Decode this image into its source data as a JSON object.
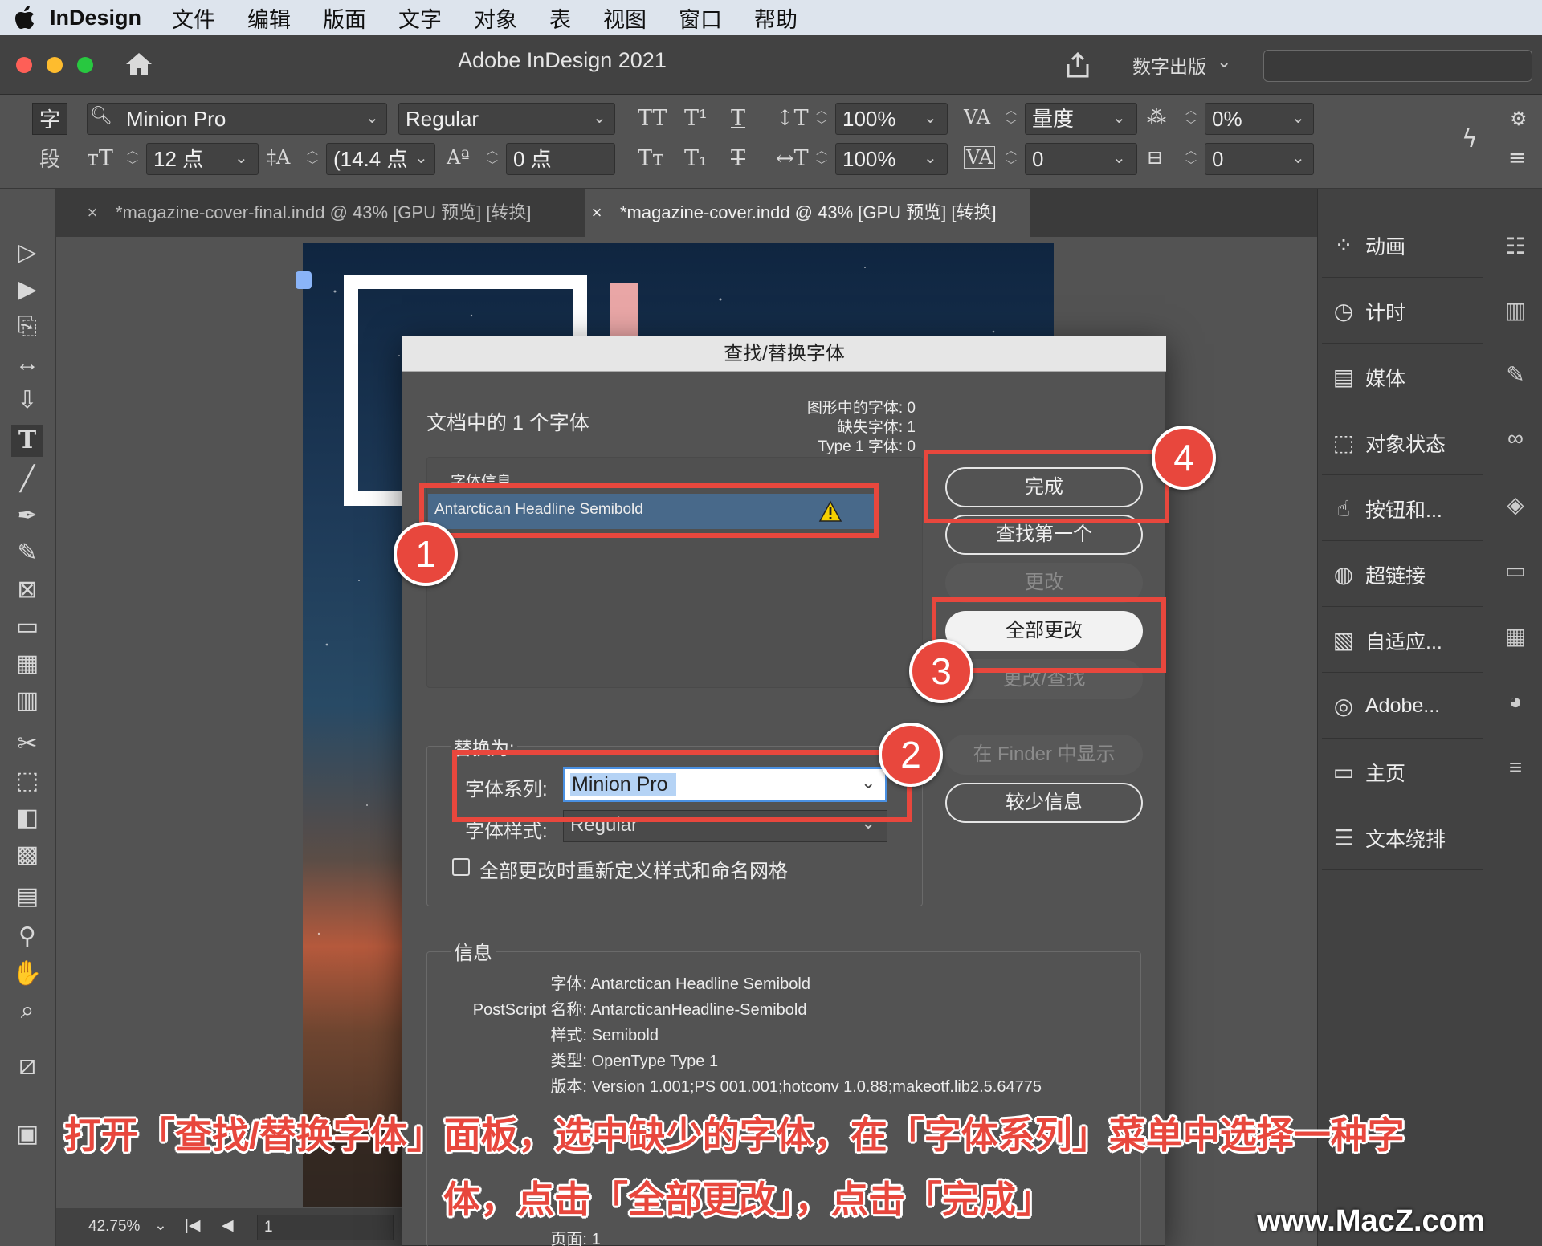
{
  "menubar": {
    "app_name": "InDesign",
    "items": [
      "文件",
      "编辑",
      "版面",
      "文字",
      "对象",
      "表",
      "视图",
      "窗口",
      "帮助"
    ]
  },
  "titlebar": {
    "title": "Adobe InDesign 2021",
    "workspace": "数字出版",
    "traffic_colors": [
      "#fe5f57",
      "#febc2e",
      "#28c840"
    ]
  },
  "control_panel": {
    "char_label": "字",
    "para_label": "段",
    "font_family": "Minion Pro",
    "font_style": "Regular",
    "font_size": "12 点",
    "leading": "(14.4 点",
    "baseline_shift": "0 点",
    "vertical_scale": "100%",
    "horizontal_scale": "100%",
    "kerning": "量度",
    "tracking": "0",
    "skew": "0%",
    "char_rotate": "0"
  },
  "tabs": [
    {
      "close": "×",
      "label": "*magazine-cover-final.indd @ 43% [GPU 预览] [转换]"
    },
    {
      "close": "×",
      "label": "*magazine-cover.indd @ 43% [GPU 预览] [转换]"
    }
  ],
  "right_panel": {
    "items": [
      "动画",
      "计时",
      "媒体",
      "对象状态",
      "按钮和...",
      "超链接",
      "自适应...",
      "Adobe...",
      "主页",
      "文本绕排"
    ]
  },
  "dialog": {
    "title": "查找/替换字体",
    "fonts_in_doc": "文档中的 1 个字体",
    "stat_graphics": "图形中的字体: 0",
    "stat_missing": "缺失字体: 1",
    "stat_type1": "Type 1 字体: 0",
    "font_info_header": "字体信息",
    "font_entry": "Antarctican Headline Semibold",
    "buttons": {
      "done": "完成",
      "find_first": "查找第一个",
      "change": "更改",
      "change_all": "全部更改",
      "change_find": "更改/查找",
      "reveal_finder": "在 Finder 中显示",
      "less_info": "较少信息"
    },
    "replace_with": "替换为:",
    "family_label": "字体系列:",
    "family_value": "Minion Pro",
    "style_label": "字体样式:",
    "style_value": "Regular",
    "redefine_checkbox": "全部更改时重新定义样式和命名网格",
    "info_header": "信息",
    "info": [
      {
        "k": "字体:",
        "v": "Antarctican Headline Semibold"
      },
      {
        "k": "PostScript 名称:",
        "v": "AntarcticanHeadline-Semibold"
      },
      {
        "k": "样式:",
        "v": "Semibold"
      },
      {
        "k": "类型:",
        "v": "OpenType Type 1"
      },
      {
        "k": "版本:",
        "v": "Version 1.001;PS 001.001;hotconv 1.0.88;makeotf.lib2.5.64775"
      },
      {
        "k": "页面:",
        "v": "1"
      }
    ]
  },
  "badges": [
    "1",
    "2",
    "3",
    "4"
  ],
  "status": {
    "zoom": "42.75%",
    "page": "1"
  },
  "caption": {
    "line1": "打开「查找/替换字体」面板，选中缺少的字体，在「字体系列」菜单中选择一种字",
    "line2": "体，点击「全部更改」，点击「完成」"
  },
  "watermark": "www.MacZ.com",
  "colors": {
    "accent_red": "#e8473d",
    "selection_blue": "#48698a",
    "canvas": "#535353"
  }
}
